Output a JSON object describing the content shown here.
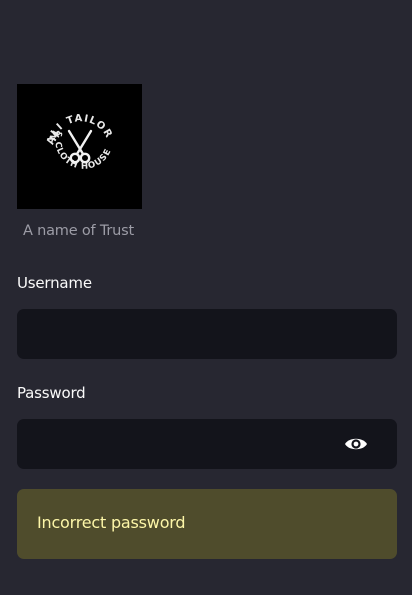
{
  "colors": {
    "background": "#272731",
    "input_background": "#13141b",
    "alert_background": "#4f4c2c",
    "alert_text": "#fdf6a8",
    "tagline_text": "#9c9ca6"
  },
  "logo": {
    "arc_top": "ALI TAILOR",
    "arc_bottom": "& CLOTH HOUSE",
    "initial": "M",
    "icon": "scissors-icon"
  },
  "tagline": "A name of Trust",
  "form": {
    "username": {
      "label": "Username",
      "value": "",
      "placeholder": ""
    },
    "password": {
      "label": "Password",
      "value": "",
      "placeholder": "",
      "toggle_icon": "eye-icon"
    }
  },
  "alert": {
    "message": "Incorrect password"
  }
}
